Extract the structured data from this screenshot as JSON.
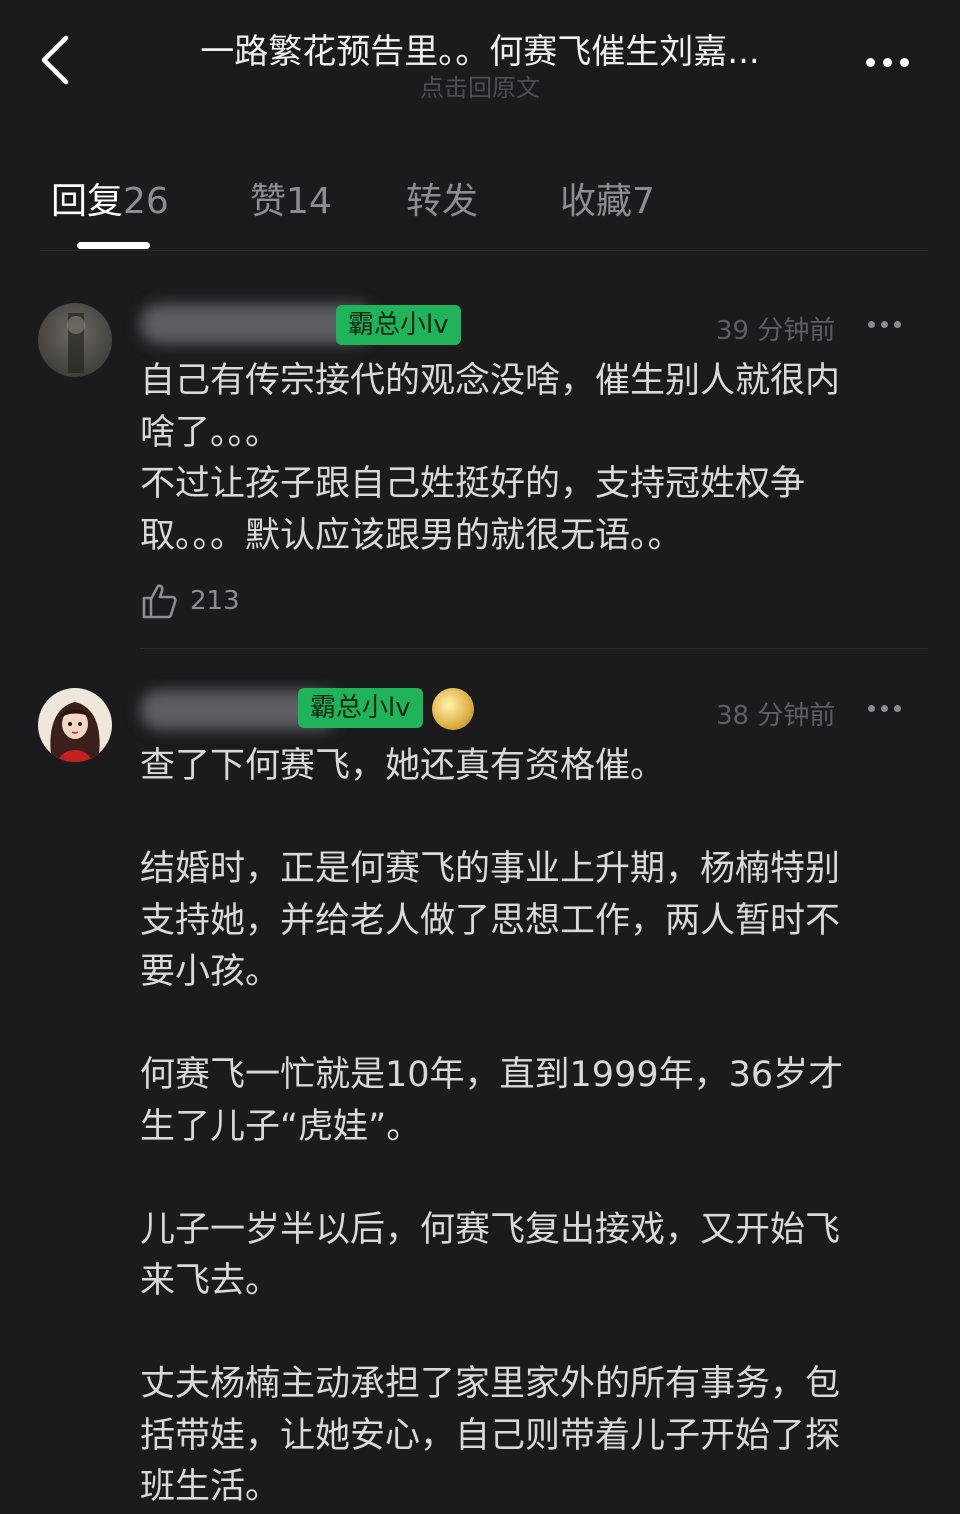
{
  "header": {
    "title": "一路繁花预告里。。何赛飞催生刘嘉...",
    "subtitle": "点击回原文"
  },
  "tabs": [
    {
      "label": "回复",
      "count": "26"
    },
    {
      "label": "赞",
      "count": "14"
    },
    {
      "label": "转发",
      "count": ""
    },
    {
      "label": "收藏",
      "count": "7"
    }
  ],
  "comments": [
    {
      "badge": "霸总小lv",
      "time": "39 分钟前",
      "lines": [
        "自己有传宗接代的观念没啥，催生别人就很内",
        "啥了。。。",
        "不过让孩子跟自己姓挺好的，支持冠姓权争",
        "取。。。默认应该跟男的就很无语。。"
      ],
      "likes": "213"
    },
    {
      "badge": "霸总小lv",
      "time": "38 分钟前",
      "lines": [
        "查了下何赛飞，她还真有资格催。",
        "",
        "结婚时，正是何赛飞的事业上升期，杨楠特别",
        "支持她，并给老人做了思想工作，两人暂时不",
        "要小孩。",
        "",
        "何赛飞一忙就是10年，直到1999年，36岁才",
        "生了儿子“虎娃”。",
        "",
        "儿子一岁半以后，何赛飞复出接戏，又开始飞",
        "来飞去。",
        "",
        "丈夫杨楠主动承担了家里家外的所有事务，包",
        "括带娃，让她安心，自己则带着儿子开始了探",
        "班生活。"
      ]
    }
  ],
  "colors": {
    "background": "#1b1b1d",
    "badge": "#1fb45a",
    "text": "#d9d9d9",
    "muted": "#8d8d91"
  }
}
